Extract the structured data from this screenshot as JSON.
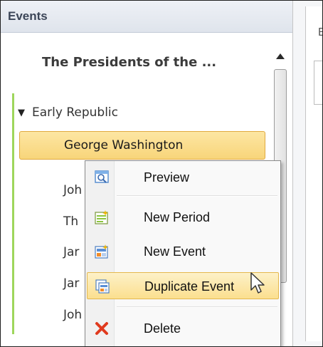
{
  "pane": {
    "title": "Events",
    "timeline_title": "The Presidents of the ...",
    "period": {
      "label": "Early Republic",
      "expanded": true
    },
    "selected_event": "George Washington",
    "events_partial": [
      "Joh",
      "Th",
      "Jar",
      "Jar",
      "Joh"
    ]
  },
  "right_pane": {
    "partial_letter": "E"
  },
  "context_menu": {
    "items": [
      {
        "label": "Preview",
        "icon": "preview-icon"
      },
      {
        "label": "New Period",
        "icon": "new-period-icon"
      },
      {
        "label": "New Event",
        "icon": "new-event-icon"
      },
      {
        "label": "Duplicate Event",
        "icon": "duplicate-event-icon",
        "hovered": true
      },
      {
        "label": "Delete",
        "icon": "delete-icon"
      }
    ]
  },
  "colors": {
    "accent_green": "#9ed65c",
    "selection_fill": "#f8d57a",
    "delete_red": "#e03a1e"
  }
}
